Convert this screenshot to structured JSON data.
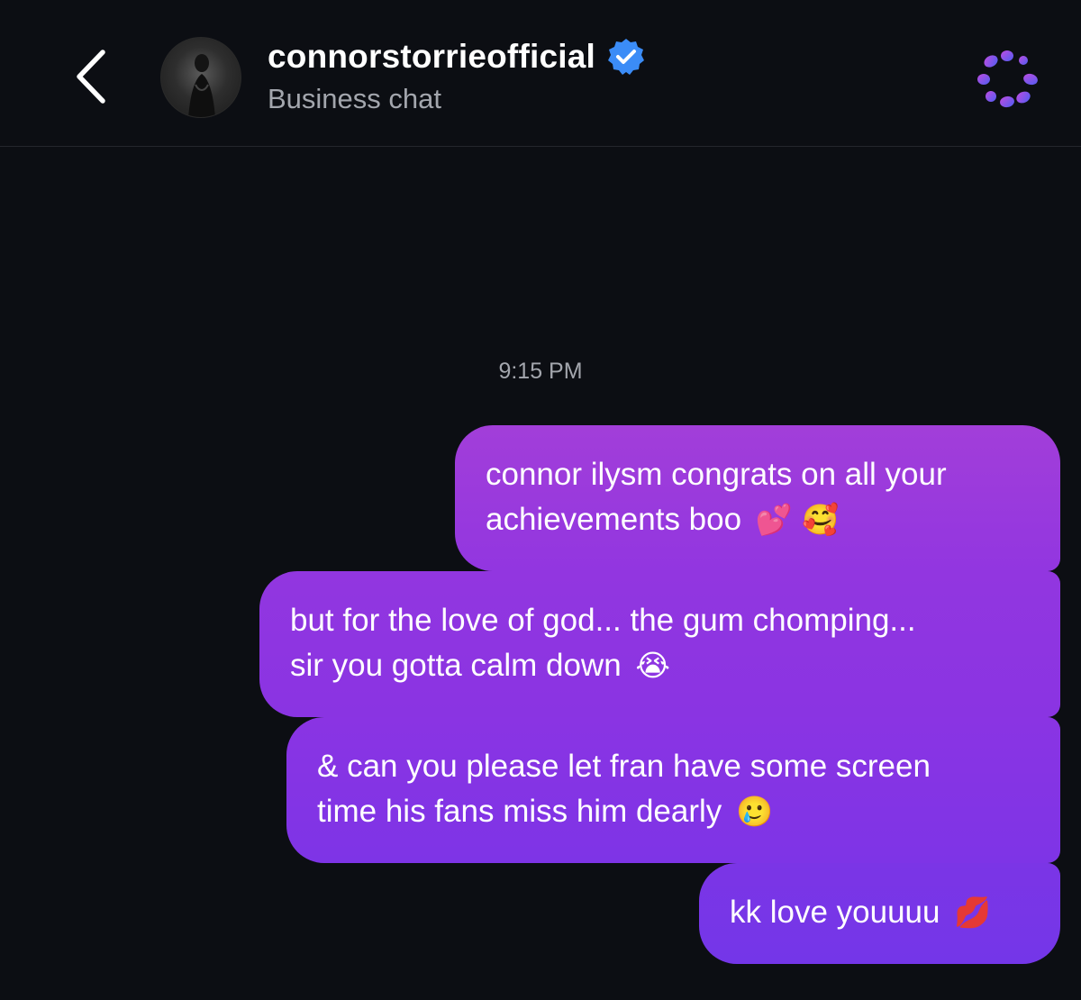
{
  "header": {
    "title": "connorstorrieofficial",
    "subtitle": "Business chat",
    "verified": true
  },
  "conversation": {
    "timestamp": "9:15 PM",
    "messages": [
      {
        "lines": [
          "connor ilysm congrats on all your",
          "achievements boo"
        ],
        "emoji": "💕 🥰"
      },
      {
        "lines": [
          "but for the love of god... the gum chomping...",
          "sir you gotta calm down"
        ],
        "emoji": "😭"
      },
      {
        "lines": [
          "& can you please let fran have some screen",
          "time his fans miss him dearly"
        ],
        "emoji": "🥲"
      },
      {
        "lines": [
          "kk love youuuu"
        ],
        "emoji": "💋"
      }
    ]
  },
  "colors": {
    "background": "#0c0e13",
    "bubble_top": "#a23ed9",
    "bubble_bottom": "#7436e8",
    "verified_badge": "#3b8cf7",
    "ai_icon_start": "#b04be0",
    "ai_icon_end": "#5b5cf0"
  },
  "icons": {
    "back": "chevron-left-icon",
    "verified": "verified-badge-icon",
    "ai": "ai-sparkle-icon"
  }
}
